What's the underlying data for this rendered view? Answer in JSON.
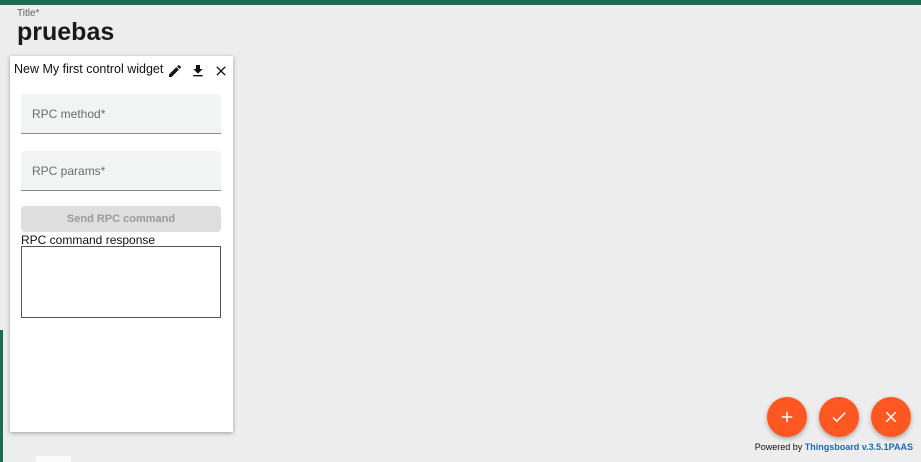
{
  "colors": {
    "top_strip": "#1f6b54",
    "fab": "#ff5722",
    "link": "#1e67b5"
  },
  "dashboard": {
    "title_label": "Title*",
    "title_value": "pruebas"
  },
  "widget": {
    "title": "New My first control widget",
    "icons": [
      "edit-icon",
      "download-icon",
      "close-icon"
    ],
    "rpc_method_placeholder": "RPC method*",
    "rpc_params_placeholder": "RPC params*",
    "send_button_label": "Send RPC command",
    "response_label": "RPC command response"
  },
  "fabs": [
    "add-icon",
    "check-icon",
    "close-icon"
  ],
  "footer": {
    "powered_prefix": "Powered by",
    "powered_link": "Thingsboard v.3.5.1PAAS"
  }
}
